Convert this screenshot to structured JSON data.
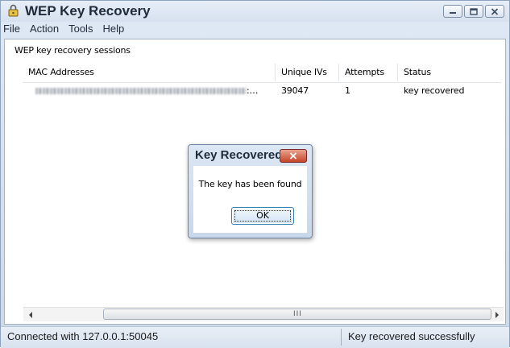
{
  "window": {
    "title": "WEP Key Recovery",
    "icons": {
      "app": "lock-key-icon",
      "minimize": "minimize-icon",
      "maximize": "maximize-icon",
      "close": "close-icon"
    }
  },
  "menu": {
    "items": [
      "File",
      "Action",
      "Tools",
      "Help"
    ]
  },
  "sessions": {
    "group_label": "WEP key recovery sessions",
    "columns": [
      "MAC Addresses",
      "Unique IVs",
      "Attempts",
      "Status"
    ],
    "rows": [
      {
        "mac_suffix": ":…",
        "unique_ivs": "39047",
        "attempts": "1",
        "status": "key recovered"
      }
    ]
  },
  "scrollbar": {
    "left_icon": "scroll-left-icon",
    "right_icon": "scroll-right-icon",
    "grip": "III"
  },
  "status_bar": {
    "left": "Connected with 127.0.0.1:50045",
    "right": "Key recovered successfully"
  },
  "dialog": {
    "title": "Key Recovered",
    "message": "The key has been found",
    "ok_label": "OK",
    "close_icon": "close-icon"
  },
  "colors": {
    "chrome": "#d6e1ef",
    "dialog_close": "#c7452b",
    "focus_border": "#3c7fb1"
  }
}
